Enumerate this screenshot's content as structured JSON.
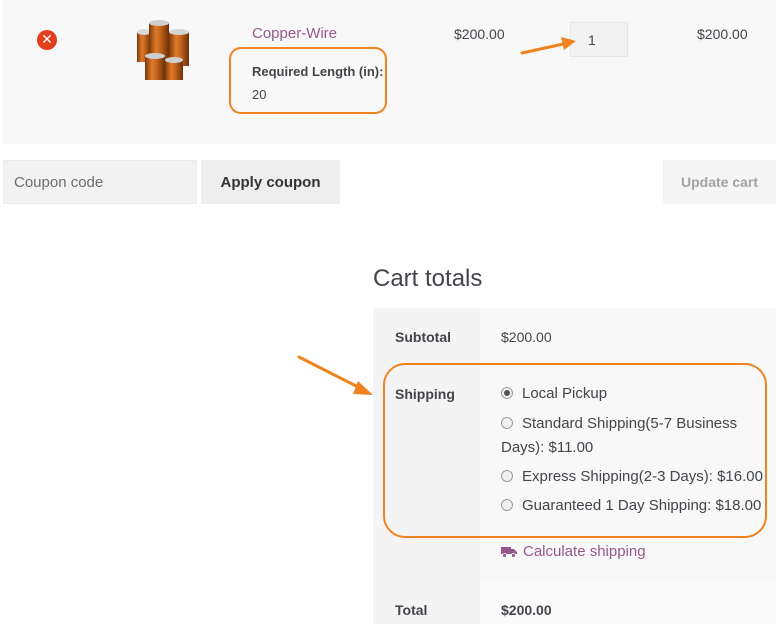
{
  "cart_item": {
    "name": "Copper-Wire",
    "meta_label": "Required Length (in):",
    "meta_value": "20",
    "price": "$200.00",
    "quantity": "1",
    "line_total": "$200.00",
    "thumbnail_icon": "copper-wire-spools-image"
  },
  "actions": {
    "coupon_placeholder": "Coupon code",
    "apply_coupon": "Apply coupon",
    "update_cart": "Update cart"
  },
  "totals": {
    "title": "Cart totals",
    "subtotal_label": "Subtotal",
    "subtotal_value": "$200.00",
    "shipping_label": "Shipping",
    "shipping_options": [
      {
        "label": "Local Pickup",
        "selected": true
      },
      {
        "label": "Standard Shipping(5-7 Business Days): $11.00",
        "selected": false
      },
      {
        "label": "Express Shipping(2-3 Days): $16.00",
        "selected": false
      },
      {
        "label": "Guaranteed 1 Day Shipping: $18.00",
        "selected": false
      }
    ],
    "calculate_shipping": "Calculate shipping",
    "total_label": "Total",
    "total_value": "$200.00"
  },
  "colors": {
    "accent": "#96588a",
    "annotation": "#f0831f",
    "remove": "#e2401c"
  }
}
